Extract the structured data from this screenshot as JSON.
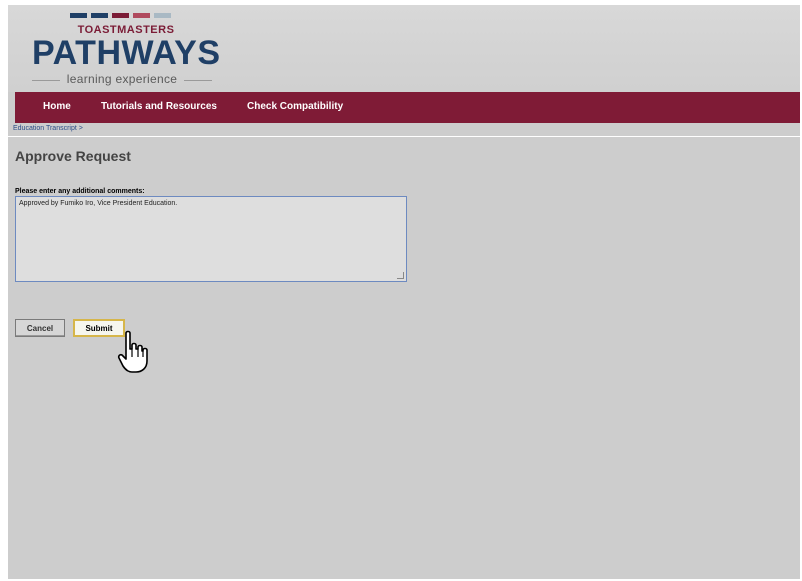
{
  "brand": {
    "stripe_colors": [
      "#1f3f66",
      "#1f3f66",
      "#7b1c36",
      "#b04a5e",
      "#a9b9c4"
    ],
    "org_name": "TOASTMASTERS",
    "product_name": "PATHWAYS",
    "tagline": "learning experience"
  },
  "nav": {
    "items": [
      {
        "label": "Home"
      },
      {
        "label": "Tutorials and Resources"
      },
      {
        "label": "Check Compatibility"
      }
    ]
  },
  "breadcrumb": {
    "text": "Education Transcript  >"
  },
  "page": {
    "title": "Approve Request"
  },
  "form": {
    "comments_label": "Please enter any additional comments:",
    "comments_value": "Approved by Fumiko Iro, Vice President Education."
  },
  "buttons": {
    "cancel": "Cancel",
    "submit": "Submit"
  },
  "colors": {
    "nav_background": "#7f1b36",
    "brand_navy": "#1f3f66",
    "brand_maroon": "#7b1c36",
    "submit_border": "#d6b64a"
  }
}
